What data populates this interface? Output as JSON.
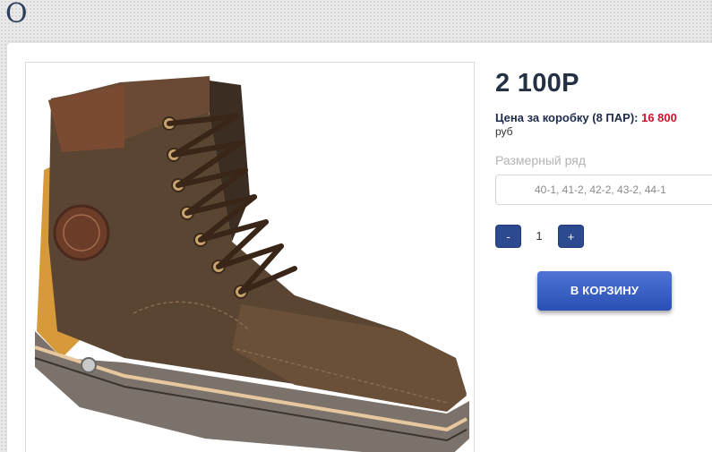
{
  "header": {
    "letter": "O"
  },
  "product": {
    "image_alt": "brown leather lace-up boot",
    "price": "2 100Р",
    "box_price_label": "Цена за коробку (8 ПАР):",
    "box_price_value": "16 800",
    "currency": "руб",
    "size_label": "Размерный ряд",
    "size_value": "40-1, 41-2, 42-2, 43-2, 44-1",
    "quantity": "1",
    "minus_label": "-",
    "plus_label": "+",
    "cart_label": "В КОРЗИНУ"
  },
  "colors": {
    "accent": "#2d4a91",
    "cart_button": "#3a5fc4",
    "price_text": "#243145",
    "highlight_red": "#d0112b"
  }
}
